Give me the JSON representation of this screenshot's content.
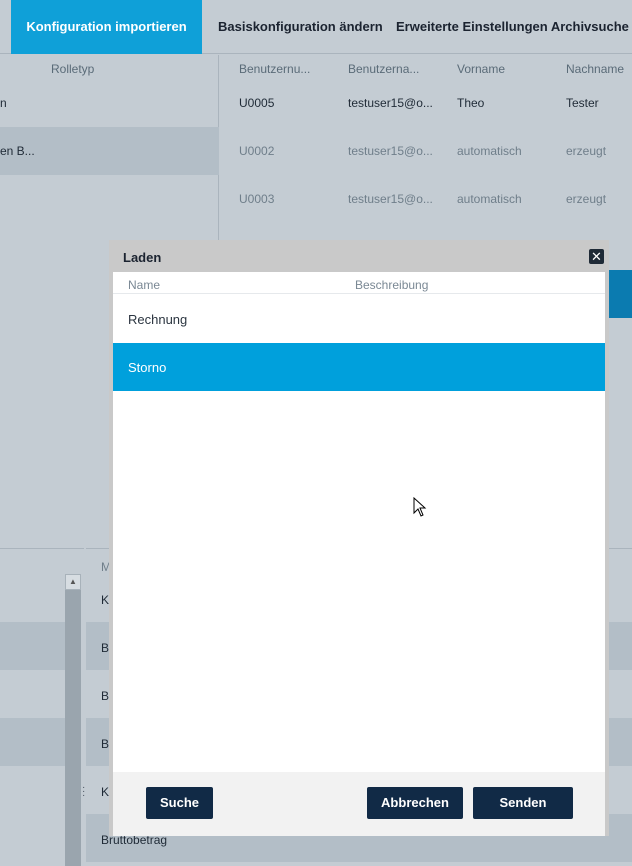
{
  "tabs": [
    {
      "label": "Konfiguration importieren",
      "active": true
    },
    {
      "label": "Basiskonfiguration ändern",
      "active": false
    },
    {
      "label": "Erweiterte Einstellungen Archivsuche",
      "active": false
    }
  ],
  "left_table": {
    "header": "Rolletyp",
    "rows": [
      "n",
      "en B..."
    ]
  },
  "right_table": {
    "headers": [
      "Benutzernu...",
      "Benutzerna...",
      "Vorname",
      "Nachname"
    ],
    "rows": [
      [
        "U0005",
        "testuser15@o...",
        "Theo",
        "Tester"
      ],
      [
        "U0002",
        "testuser15@o...",
        "automatisch",
        "erzeugt"
      ],
      [
        "U0003",
        "testuser15@o...",
        "automatisch",
        "erzeugt"
      ]
    ]
  },
  "bottom_table": {
    "header_fragment": "M",
    "rows": [
      "K",
      "B",
      "B",
      "B",
      "K",
      "Bruttobetrag"
    ]
  },
  "dialog": {
    "title": "Laden",
    "close_glyph": "✕",
    "columns": {
      "name": "Name",
      "description": "Beschreibung"
    },
    "items": [
      {
        "name": "Rechnung",
        "description": "",
        "selected": false
      },
      {
        "name": "Storno",
        "description": "",
        "selected": true
      }
    ],
    "buttons": {
      "search": "Suche",
      "cancel": "Abbrechen",
      "send": "Senden"
    }
  },
  "colors": {
    "accent": "#00a0dc",
    "tab_active": "#0fa0d8",
    "button": "#112a46",
    "overlay_bg": "#c4ccd3"
  },
  "icons": [
    "close-icon",
    "scroll-up-icon",
    "drag-handle-icon",
    "mouse-cursor-icon"
  ]
}
